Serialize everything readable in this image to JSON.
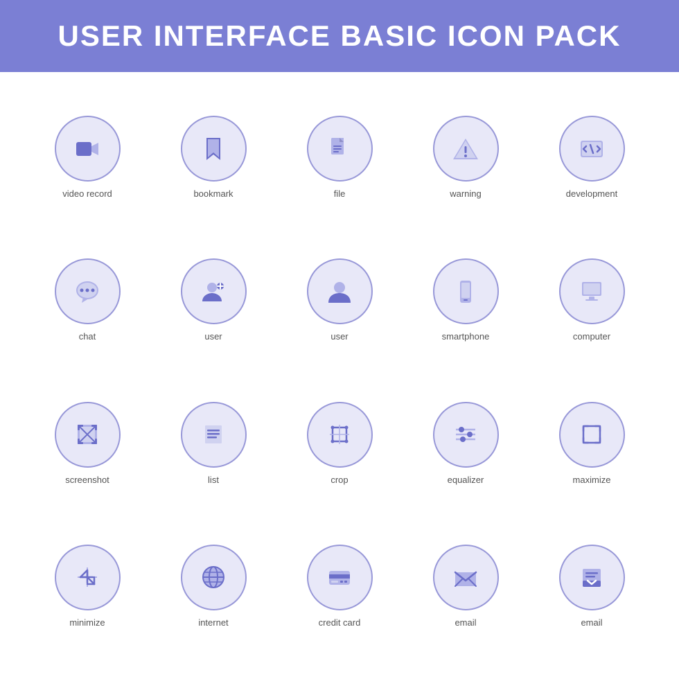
{
  "header": {
    "title": "USER INTERFACE BASIC ICON PACK"
  },
  "icons": [
    {
      "name": "video-record",
      "label": "video record"
    },
    {
      "name": "bookmark",
      "label": "bookmark"
    },
    {
      "name": "file",
      "label": "file"
    },
    {
      "name": "warning",
      "label": "warning"
    },
    {
      "name": "development",
      "label": "development"
    },
    {
      "name": "chat",
      "label": "chat"
    },
    {
      "name": "user1",
      "label": "user"
    },
    {
      "name": "user2",
      "label": "user"
    },
    {
      "name": "smartphone",
      "label": "smartphone"
    },
    {
      "name": "computer",
      "label": "computer"
    },
    {
      "name": "screenshot",
      "label": "screenshot"
    },
    {
      "name": "list",
      "label": "list"
    },
    {
      "name": "crop",
      "label": "crop"
    },
    {
      "name": "equalizer",
      "label": "equalizer"
    },
    {
      "name": "maximize",
      "label": "maximize"
    },
    {
      "name": "minimize",
      "label": "minimize"
    },
    {
      "name": "internet",
      "label": "internet"
    },
    {
      "name": "credit-card",
      "label": "credit card"
    },
    {
      "name": "email1",
      "label": "email"
    },
    {
      "name": "email2",
      "label": "email"
    }
  ],
  "colors": {
    "header_bg": "#7b7fd4",
    "header_text": "#ffffff",
    "circle_bg": "#e8e8f8",
    "circle_border": "#9898d8",
    "icon_accent": "#6b6ec9",
    "icon_light": "#b0b2e8",
    "label_color": "#666666"
  }
}
